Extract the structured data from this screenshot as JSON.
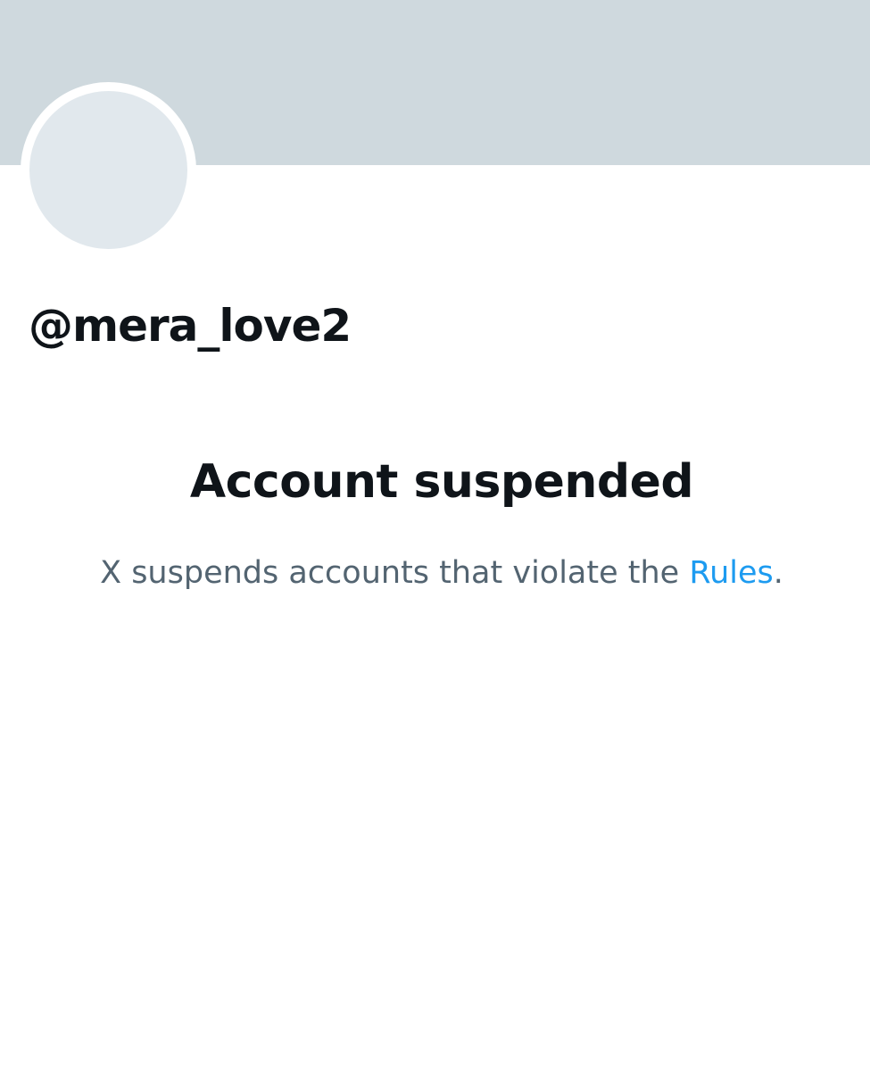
{
  "profile": {
    "handle": "@mera_love2"
  },
  "suspension": {
    "title": "Account suspended",
    "message_prefix": "X suspends accounts that violate the ",
    "rules_link_label": "Rules",
    "message_suffix": "."
  },
  "colors": {
    "banner": "#cfd9de",
    "avatar": "#e1e8ed",
    "text_primary": "#0f1419",
    "text_secondary": "#536471",
    "link": "#1d9bf0"
  }
}
